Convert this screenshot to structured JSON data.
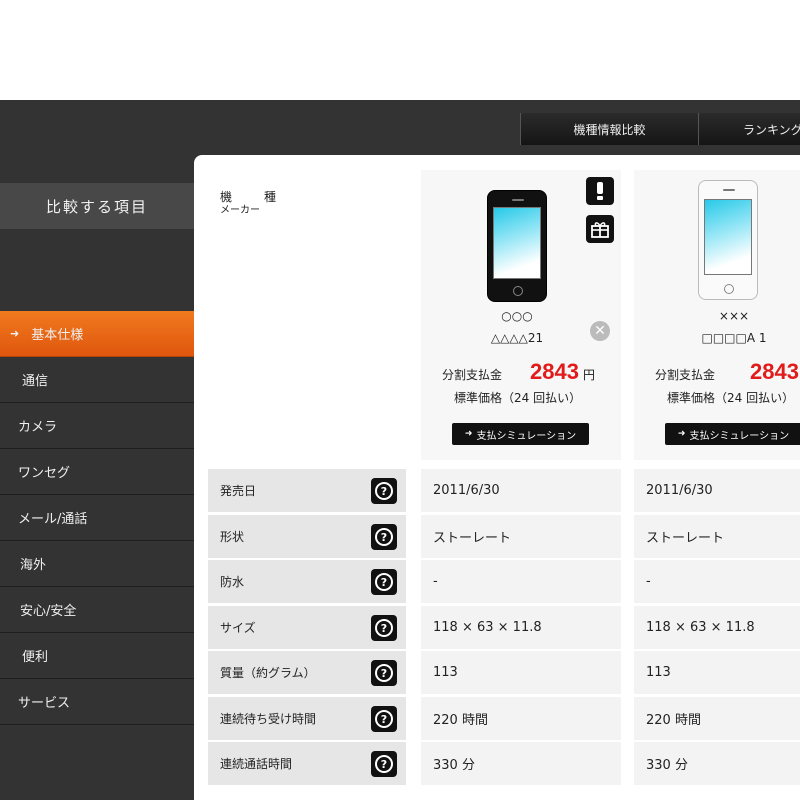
{
  "tabs": [
    {
      "label": "機種情報比較"
    },
    {
      "label": "ランキング"
    }
  ],
  "compare_title": "比較する項目",
  "sidebar": {
    "items": [
      {
        "label": "基本仕様",
        "active": true
      },
      {
        "label": "通信"
      },
      {
        "label": "カメラ"
      },
      {
        "label": "ワンセグ"
      },
      {
        "label": "メール/通話"
      },
      {
        "label": "海外"
      },
      {
        "label": "安心/安全"
      },
      {
        "label": "便利"
      },
      {
        "label": "サービス"
      }
    ]
  },
  "header_labels": {
    "model": "機　種",
    "maker": "メーカー"
  },
  "phones": [
    {
      "maker": "○○○",
      "model": "△△△△21",
      "color": "black",
      "installment_label": "分割支払金",
      "installment_value": "2843",
      "unit": "円",
      "standard_price": "標準価格（24 回払い）",
      "sim_button": "支払シミュレーション"
    },
    {
      "maker": "×××",
      "model": "□□□□A 1",
      "color": "white",
      "installment_label": "分割支払金",
      "installment_value": "2843",
      "unit": "",
      "standard_price": "標準価格（24 回払い）",
      "sim_button": "支払シミュレーション"
    }
  ],
  "specs": [
    {
      "label": "発売日",
      "values": [
        "2011/6/30",
        "2011/6/30"
      ]
    },
    {
      "label": "形状",
      "values": [
        "ストーレート",
        "ストーレート"
      ]
    },
    {
      "label": "防水",
      "values": [
        "-",
        "-"
      ]
    },
    {
      "label": "サイズ",
      "values": [
        "118 × 63 × 11.8",
        "118 × 63 × 11.8"
      ]
    },
    {
      "label": "質量（約グラム）",
      "values": [
        "113",
        "113"
      ]
    },
    {
      "label": "連続待ち受け時間",
      "values": [
        "220 時間",
        "220 時間"
      ]
    },
    {
      "label": "連続通話時間",
      "values": [
        "330 分",
        "330 分"
      ]
    }
  ],
  "help_glyph": "?",
  "colors": {
    "accent": "#ea6616",
    "price": "#e21a1a",
    "bg_dark": "#333333"
  }
}
